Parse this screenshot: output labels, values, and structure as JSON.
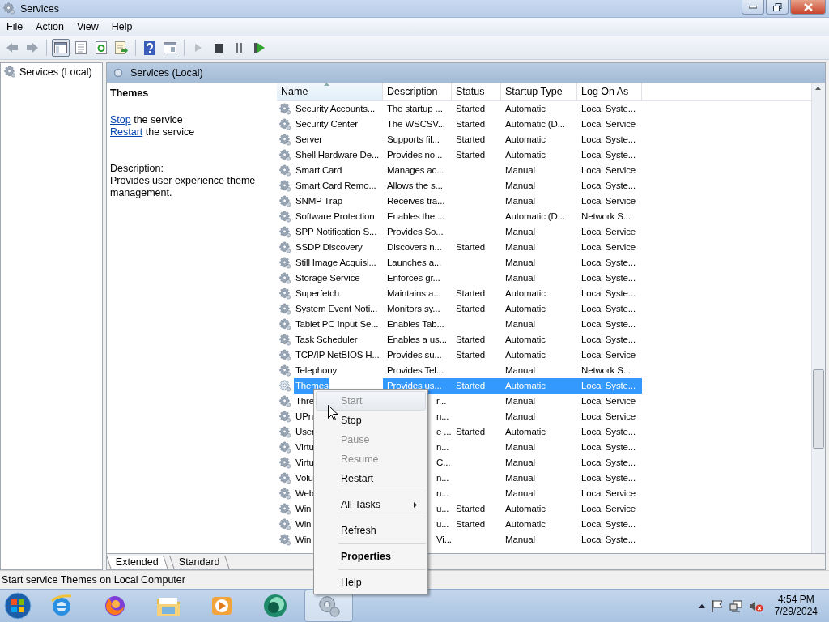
{
  "window": {
    "title": "Services"
  },
  "menu_bar": [
    "File",
    "Action",
    "View",
    "Help"
  ],
  "toolbar": [
    {
      "kind": "back",
      "pressed": false
    },
    {
      "kind": "forward",
      "pressed": false
    },
    {
      "kind": "separator"
    },
    {
      "kind": "console-tree",
      "pressed": true
    },
    {
      "kind": "properties",
      "pressed": false
    },
    {
      "kind": "refresh",
      "pressed": false
    },
    {
      "kind": "export",
      "pressed": false
    },
    {
      "kind": "separator"
    },
    {
      "kind": "help",
      "pressed": false
    },
    {
      "kind": "view",
      "pressed": false
    },
    {
      "kind": "separator"
    },
    {
      "kind": "start",
      "pressed": false
    },
    {
      "kind": "stop",
      "pressed": false
    },
    {
      "kind": "pause",
      "pressed": false
    },
    {
      "kind": "restart",
      "pressed": false
    }
  ],
  "tree": {
    "items": [
      {
        "label": "Services (Local)"
      }
    ]
  },
  "panel": {
    "title": "Services (Local)"
  },
  "details": {
    "title": "Themes",
    "actions": [
      {
        "link": "Stop",
        "text": " the service"
      },
      {
        "link": "Restart",
        "text": " the service"
      }
    ],
    "description_label": "Description:",
    "description": "Provides user experience theme management."
  },
  "table": {
    "columns": [
      {
        "label": "Name",
        "sorted": true
      },
      {
        "label": "Description",
        "sorted": false
      },
      {
        "label": "Status",
        "sorted": false
      },
      {
        "label": "Startup Type",
        "sorted": false
      },
      {
        "label": "Log On As",
        "sorted": false
      }
    ],
    "rows": [
      {
        "name": "Security Accounts...",
        "description": "The startup ...",
        "status": "Started",
        "startup": "Automatic",
        "logon": "Local Syste...",
        "selected": false,
        "covered": false
      },
      {
        "name": "Security Center",
        "description": "The WSCSV...",
        "status": "Started",
        "startup": "Automatic (D...",
        "logon": "Local Service",
        "selected": false,
        "covered": false
      },
      {
        "name": "Server",
        "description": "Supports fil...",
        "status": "Started",
        "startup": "Automatic",
        "logon": "Local Syste...",
        "selected": false,
        "covered": false
      },
      {
        "name": "Shell Hardware De...",
        "description": "Provides no...",
        "status": "Started",
        "startup": "Automatic",
        "logon": "Local Syste...",
        "selected": false,
        "covered": false
      },
      {
        "name": "Smart Card",
        "description": "Manages ac...",
        "startup": "Manual",
        "logon": "Local Service",
        "selected": false,
        "covered": false
      },
      {
        "name": "Smart Card Remo...",
        "description": "Allows the s...",
        "startup": "Manual",
        "logon": "Local Syste...",
        "selected": false,
        "covered": false
      },
      {
        "name": "SNMP Trap",
        "description": "Receives tra...",
        "startup": "Manual",
        "logon": "Local Service",
        "selected": false,
        "covered": false
      },
      {
        "name": "Software Protection",
        "description": "Enables the ...",
        "startup": "Automatic (D...",
        "logon": "Network S...",
        "selected": false,
        "covered": false
      },
      {
        "name": "SPP Notification S...",
        "description": "Provides So...",
        "startup": "Manual",
        "logon": "Local Service",
        "selected": false,
        "covered": false
      },
      {
        "name": "SSDP Discovery",
        "description": "Discovers n...",
        "status": "Started",
        "startup": "Manual",
        "logon": "Local Service",
        "selected": false,
        "covered": false
      },
      {
        "name": "Still Image Acquisi...",
        "description": "Launches a...",
        "startup": "Manual",
        "logon": "Local Syste...",
        "selected": false,
        "covered": false
      },
      {
        "name": "Storage Service",
        "description": "Enforces gr...",
        "startup": "Manual",
        "logon": "Local Syste...",
        "selected": false,
        "covered": false
      },
      {
        "name": "Superfetch",
        "description": "Maintains a...",
        "status": "Started",
        "startup": "Automatic",
        "logon": "Local Syste...",
        "selected": false,
        "covered": false
      },
      {
        "name": "System Event Noti...",
        "description": "Monitors sy...",
        "status": "Started",
        "startup": "Automatic",
        "logon": "Local Syste...",
        "selected": false,
        "covered": false
      },
      {
        "name": "Tablet PC Input Se...",
        "description": "Enables Tab...",
        "startup": "Manual",
        "logon": "Local Syste...",
        "selected": false,
        "covered": false
      },
      {
        "name": "Task Scheduler",
        "description": "Enables a us...",
        "status": "Started",
        "startup": "Automatic",
        "logon": "Local Syste...",
        "selected": false,
        "covered": false
      },
      {
        "name": "TCP/IP NetBIOS H...",
        "description": "Provides su...",
        "status": "Started",
        "startup": "Automatic",
        "logon": "Local Service",
        "selected": false,
        "covered": false
      },
      {
        "name": "Telephony",
        "description": "Provides Tel...",
        "startup": "Manual",
        "logon": "Network S...",
        "selected": false,
        "covered": false
      },
      {
        "name": "Themes",
        "description": "Provides us...",
        "status": "Started",
        "startup": "Automatic",
        "logon": "Local Syste...",
        "selected": true,
        "covered": false
      },
      {
        "name": "Thre",
        "description": "r...",
        "startup": "Manual",
        "logon": "Local Service",
        "selected": false,
        "covered": true
      },
      {
        "name": "UPn",
        "description": "n...",
        "startup": "Manual",
        "logon": "Local Service",
        "selected": false,
        "covered": true
      },
      {
        "name": "User",
        "description": "e ...",
        "status": "Started",
        "startup": "Automatic",
        "logon": "Local Syste...",
        "selected": false,
        "covered": true
      },
      {
        "name": "Virtu",
        "description": "n...",
        "startup": "Manual",
        "logon": "Local Syste...",
        "selected": false,
        "covered": true
      },
      {
        "name": "Virtu",
        "description": "C...",
        "startup": "Manual",
        "logon": "Local Syste...",
        "selected": false,
        "covered": true
      },
      {
        "name": "Volu",
        "description": "n...",
        "startup": "Manual",
        "logon": "Local Syste...",
        "selected": false,
        "covered": true
      },
      {
        "name": "Web",
        "description": "n...",
        "startup": "Manual",
        "logon": "Local Service",
        "selected": false,
        "covered": true
      },
      {
        "name": "Win",
        "description": "u...",
        "status": "Started",
        "startup": "Automatic",
        "logon": "Local Service",
        "selected": false,
        "covered": true
      },
      {
        "name": "Win",
        "description": "u...",
        "status": "Started",
        "startup": "Automatic",
        "logon": "Local Syste...",
        "selected": false,
        "covered": true
      },
      {
        "name": "Win",
        "description": "Vi...",
        "startup": "Manual",
        "logon": "Local Syste...",
        "selected": false,
        "covered": true
      }
    ]
  },
  "view_tabs": [
    {
      "label": "Extended",
      "selected": true
    },
    {
      "label": "Standard",
      "selected": false
    }
  ],
  "context_menu": [
    {
      "kind": "item",
      "label": "Start",
      "disabled": true,
      "selected": true,
      "bold": false,
      "submenu": false
    },
    {
      "kind": "item",
      "label": "Stop",
      "disabled": false,
      "selected": false,
      "bold": false,
      "submenu": false
    },
    {
      "kind": "item",
      "label": "Pause",
      "disabled": true,
      "selected": false,
      "bold": false,
      "submenu": false
    },
    {
      "kind": "item",
      "label": "Resume",
      "disabled": true,
      "selected": false,
      "bold": false,
      "submenu": false
    },
    {
      "kind": "item",
      "label": "Restart",
      "disabled": false,
      "selected": false,
      "bold": false,
      "submenu": false
    },
    {
      "kind": "separator"
    },
    {
      "kind": "item",
      "label": "All Tasks",
      "disabled": false,
      "selected": false,
      "bold": false,
      "submenu": true
    },
    {
      "kind": "separator"
    },
    {
      "kind": "item",
      "label": "Refresh",
      "disabled": false,
      "selected": false,
      "bold": false,
      "submenu": false
    },
    {
      "kind": "separator"
    },
    {
      "kind": "item",
      "label": "Properties",
      "disabled": false,
      "selected": false,
      "bold": true,
      "submenu": false
    },
    {
      "kind": "separator"
    },
    {
      "kind": "item",
      "label": "Help",
      "disabled": false,
      "selected": false,
      "bold": false,
      "submenu": false
    }
  ],
  "status_bar": "Start service Themes on Local Computer",
  "taskbar": {
    "apps": [
      {
        "kind": "browser-e",
        "selected": false
      },
      {
        "kind": "browser-fox",
        "selected": false
      },
      {
        "kind": "folder",
        "selected": false
      },
      {
        "kind": "media",
        "selected": false
      },
      {
        "kind": "green-app",
        "selected": false
      },
      {
        "kind": "services",
        "selected": true
      }
    ],
    "time": "4:54 PM",
    "date": "7/29/2024"
  }
}
